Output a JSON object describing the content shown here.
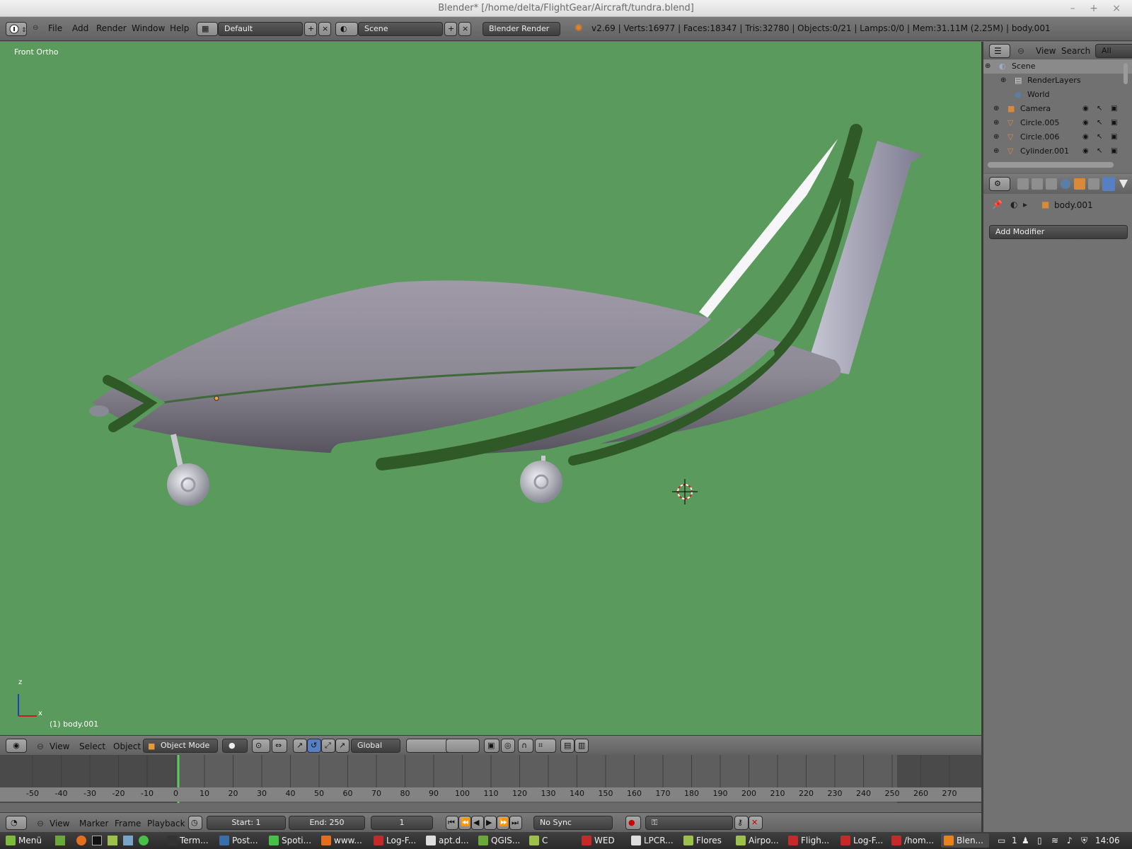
{
  "window": {
    "title": "Blender* [/home/delta/FlightGear/Aircraft/tundra.blend]",
    "controls": "– + ×"
  },
  "infobar": {
    "menus": [
      "File",
      "Add",
      "Render",
      "Window",
      "Help"
    ],
    "layout": "Default",
    "scene": "Scene",
    "engine": "Blender Render",
    "stats": "v2.69 | Verts:16977 | Faces:18347 | Tris:32780 | Objects:0/21 | Lamps:0/0 | Mem:31.11M (2.25M) | body.001"
  },
  "viewport": {
    "view_label": "Front Ortho",
    "object_label": "(1) body.001",
    "axis_z": "z",
    "axis_x": "x",
    "background": "#5a9a5c"
  },
  "view3d_header": {
    "menus": [
      "View",
      "Select",
      "Object"
    ],
    "mode": "Object Mode",
    "orientation": "Global"
  },
  "timeline": {
    "ruler": [
      "-50",
      "-40",
      "-30",
      "-20",
      "-10",
      "0",
      "10",
      "20",
      "30",
      "40",
      "50",
      "60",
      "70",
      "80",
      "90",
      "100",
      "110",
      "120",
      "130",
      "140",
      "150",
      "160",
      "170",
      "180",
      "190",
      "200",
      "210",
      "220",
      "230",
      "240",
      "250",
      "260",
      "270"
    ],
    "menus": [
      "View",
      "Marker",
      "Frame",
      "Playback"
    ],
    "start": "Start: 1",
    "end": "End: 250",
    "current": "1",
    "sync": "No Sync"
  },
  "outliner": {
    "menus": [
      "View",
      "Search",
      "All Scenes"
    ],
    "rows": [
      {
        "label": "Scene",
        "icon": "scene-icon"
      },
      {
        "label": "RenderLayers",
        "icon": "renderlayers-icon"
      },
      {
        "label": "World",
        "icon": "world-icon"
      },
      {
        "label": "Camera",
        "icon": "camera-icon"
      },
      {
        "label": "Circle.005",
        "icon": "mesh-icon"
      },
      {
        "label": "Circle.006",
        "icon": "mesh-icon"
      },
      {
        "label": "Cylinder.001",
        "icon": "mesh-icon"
      }
    ]
  },
  "properties": {
    "object_name": "body.001",
    "add_modifier": "Add Modifier"
  },
  "taskbar": {
    "menu": "Menü",
    "tasks": [
      "Term...",
      "Post...",
      "Spoti...",
      "www...",
      "Log-F...",
      "apt.d...",
      "QGIS...",
      "C",
      "WED",
      "LPCR...",
      "Flores",
      "Airpo...",
      "Fligh...",
      "Log-F...",
      "/hom...",
      "Blen..."
    ],
    "workspace": "1",
    "clock": "14:06"
  }
}
